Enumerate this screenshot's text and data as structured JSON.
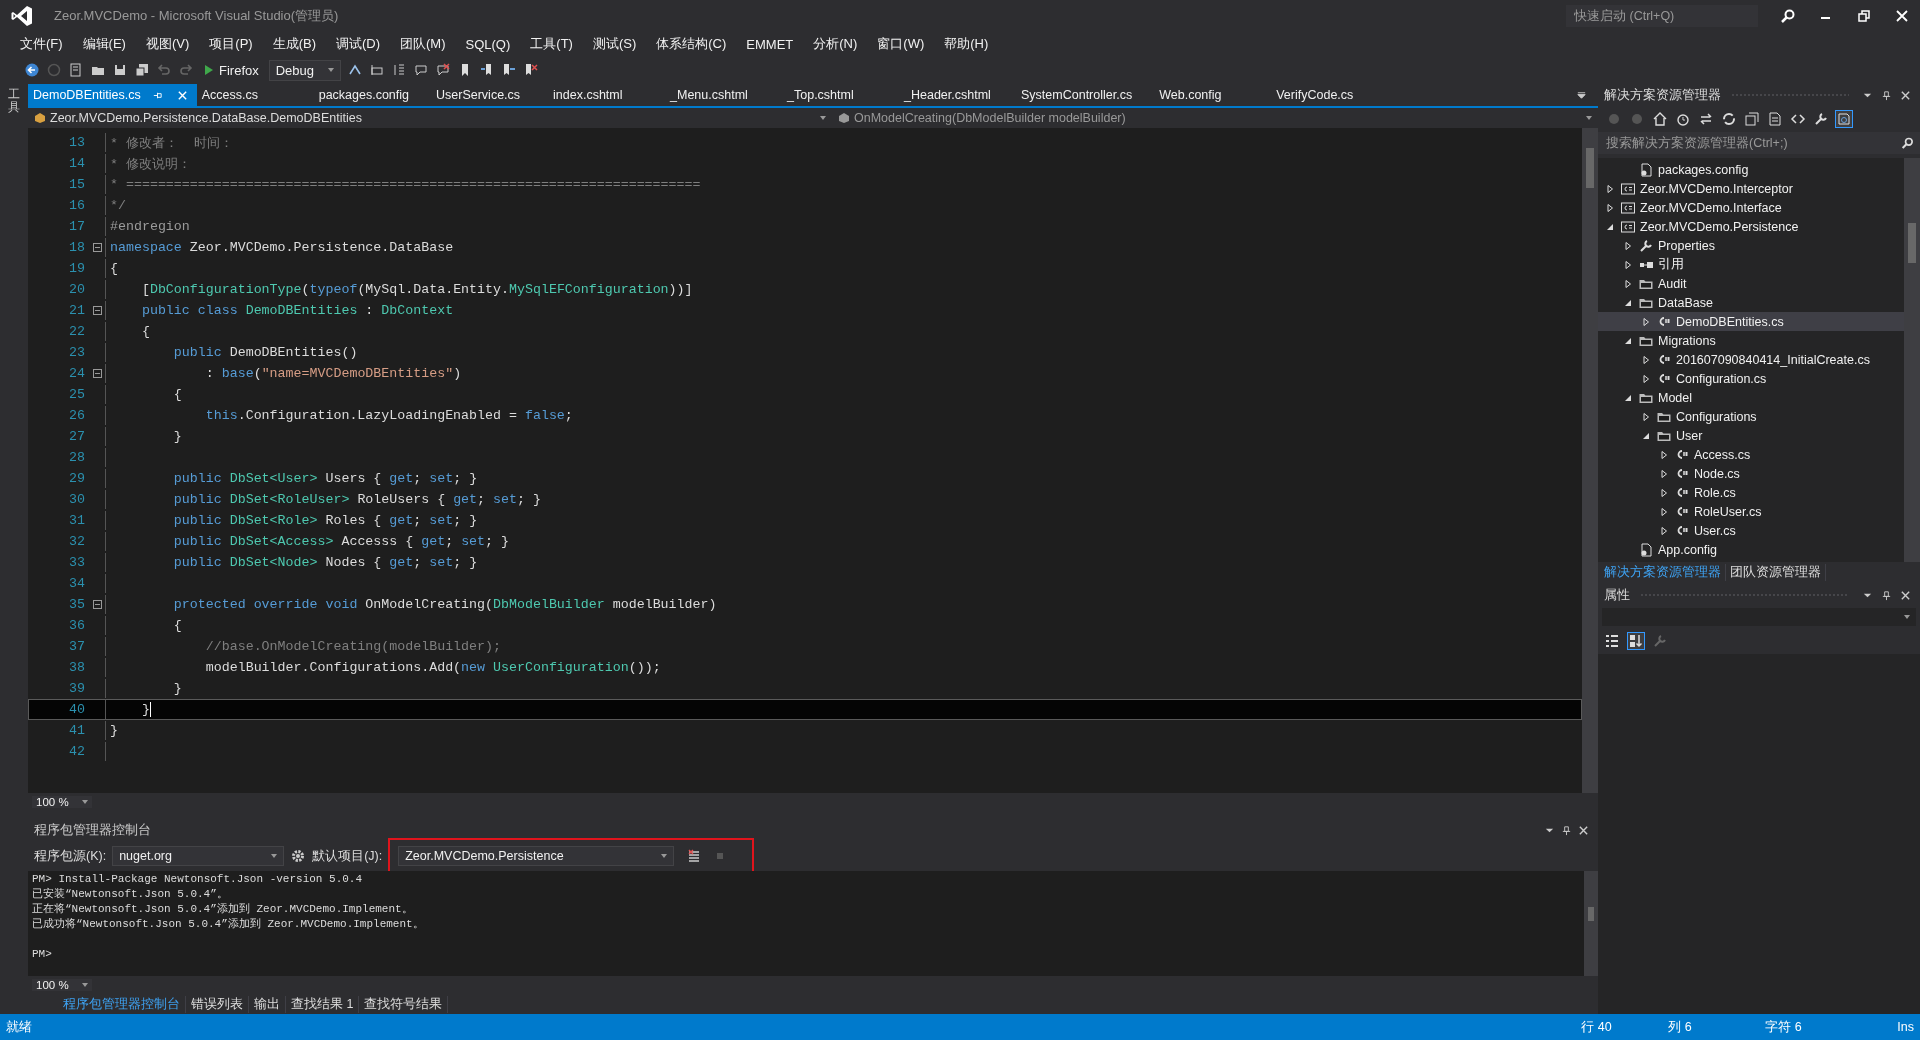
{
  "window": {
    "title": "Zeor.MVCDemo - Microsoft Visual Studio(管理员)",
    "quick_launch": {
      "placeholder": "快速启动 (Ctrl+Q)"
    }
  },
  "menu": [
    "文件(F)",
    "编辑(E)",
    "视图(V)",
    "项目(P)",
    "生成(B)",
    "调试(D)",
    "团队(M)",
    "SQL(Q)",
    "工具(T)",
    "测试(S)",
    "体系结构(C)",
    "EMMET",
    "分析(N)",
    "窗口(W)",
    "帮助(H)"
  ],
  "toolbar": {
    "browser": "Firefox",
    "configuration": "Debug"
  },
  "left_strip": {
    "label": "工具"
  },
  "tabs": [
    {
      "label": "DemoDBEntities.cs",
      "selected": true
    },
    {
      "label": "Access.cs",
      "selected": false
    },
    {
      "label": "packages.config",
      "selected": false
    },
    {
      "label": "UserService.cs",
      "selected": false
    },
    {
      "label": "index.cshtml",
      "selected": false
    },
    {
      "label": "_Menu.cshtml",
      "selected": false
    },
    {
      "label": "_Top.cshtml",
      "selected": false
    },
    {
      "label": "_Header.cshtml",
      "selected": false
    },
    {
      "label": "SystemController.cs",
      "selected": false
    },
    {
      "label": "Web.config",
      "selected": false
    },
    {
      "label": "VerifyCode.cs",
      "selected": false
    }
  ],
  "navigation": {
    "type": "Zeor.MVCDemo.Persistence.DataBase.DemoDBEntities",
    "member": "OnModelCreating(DbModelBuilder modelBuilder)"
  },
  "code_lines": [
    {
      "n": "13",
      "foldable": false,
      "current": false,
      "tokens": [
        {
          "kind": "comment",
          "text": "* 修改者：  时间："
        }
      ]
    },
    {
      "n": "14",
      "foldable": false,
      "current": false,
      "tokens": [
        {
          "kind": "comment",
          "text": "* 修改说明："
        }
      ]
    },
    {
      "n": "15",
      "foldable": false,
      "current": false,
      "tokens": [
        {
          "kind": "comment",
          "text": "* ========================================================================"
        }
      ]
    },
    {
      "n": "16",
      "foldable": false,
      "current": false,
      "tokens": [
        {
          "kind": "comment",
          "text": "*/"
        }
      ]
    },
    {
      "n": "17",
      "foldable": false,
      "current": false,
      "tokens": [
        {
          "kind": "pre",
          "text": "#endregion"
        }
      ]
    },
    {
      "n": "18",
      "foldable": true,
      "current": false,
      "tokens": [
        {
          "kind": "keyword",
          "text": "namespace"
        },
        {
          "kind": "plain",
          "text": " Zeor.MVCDemo.Persistence.DataBase"
        }
      ]
    },
    {
      "n": "19",
      "foldable": false,
      "current": false,
      "tokens": [
        {
          "kind": "plain",
          "text": "{"
        }
      ]
    },
    {
      "n": "20",
      "foldable": false,
      "current": false,
      "tokens": [
        {
          "kind": "plain",
          "text": "    ["
        },
        {
          "kind": "type",
          "text": "DbConfigurationType"
        },
        {
          "kind": "plain",
          "text": "("
        },
        {
          "kind": "keyword",
          "text": "typeof"
        },
        {
          "kind": "plain",
          "text": "(MySql.Data.Entity."
        },
        {
          "kind": "type",
          "text": "MySqlEFConfiguration"
        },
        {
          "kind": "plain",
          "text": "))]"
        }
      ]
    },
    {
      "n": "21",
      "foldable": true,
      "current": false,
      "tokens": [
        {
          "kind": "keyword",
          "text": "    public class "
        },
        {
          "kind": "type",
          "text": "DemoDBEntities"
        },
        {
          "kind": "plain",
          "text": " : "
        },
        {
          "kind": "type",
          "text": "DbContext"
        }
      ]
    },
    {
      "n": "22",
      "foldable": false,
      "current": false,
      "tokens": [
        {
          "kind": "plain",
          "text": "    {"
        }
      ]
    },
    {
      "n": "23",
      "foldable": false,
      "current": false,
      "tokens": [
        {
          "kind": "keyword",
          "text": "        public"
        },
        {
          "kind": "plain",
          "text": " DemoDBEntities()"
        }
      ]
    },
    {
      "n": "24",
      "foldable": true,
      "current": false,
      "tokens": [
        {
          "kind": "plain",
          "text": "            : "
        },
        {
          "kind": "keyword",
          "text": "base"
        },
        {
          "kind": "plain",
          "text": "("
        },
        {
          "kind": "string",
          "text": "\"name=MVCDemoDBEntities\""
        },
        {
          "kind": "plain",
          "text": ")"
        }
      ]
    },
    {
      "n": "25",
      "foldable": false,
      "current": false,
      "tokens": [
        {
          "kind": "plain",
          "text": "        {"
        }
      ]
    },
    {
      "n": "26",
      "foldable": false,
      "current": false,
      "tokens": [
        {
          "kind": "keyword",
          "text": "            this"
        },
        {
          "kind": "plain",
          "text": ".Configuration.LazyLoadingEnabled = "
        },
        {
          "kind": "keyword",
          "text": "false"
        },
        {
          "kind": "plain",
          "text": ";"
        }
      ]
    },
    {
      "n": "27",
      "foldable": false,
      "current": false,
      "tokens": [
        {
          "kind": "plain",
          "text": "        }"
        }
      ]
    },
    {
      "n": "28",
      "foldable": false,
      "current": false
    },
    {
      "n": "29",
      "foldable": false,
      "current": false,
      "tokens": [
        {
          "kind": "keyword",
          "text": "        public "
        },
        {
          "kind": "type",
          "text": "DbSet<User>"
        },
        {
          "kind": "plain",
          "text": " Users { "
        },
        {
          "kind": "keyword",
          "text": "get"
        },
        {
          "kind": "plain",
          "text": "; "
        },
        {
          "kind": "keyword",
          "text": "set"
        },
        {
          "kind": "plain",
          "text": "; }"
        }
      ]
    },
    {
      "n": "30",
      "foldable": false,
      "current": false,
      "tokens": [
        {
          "kind": "keyword",
          "text": "        public "
        },
        {
          "kind": "type",
          "text": "DbSet<RoleUser>"
        },
        {
          "kind": "plain",
          "text": " RoleUsers { "
        },
        {
          "kind": "keyword",
          "text": "get"
        },
        {
          "kind": "plain",
          "text": "; "
        },
        {
          "kind": "keyword",
          "text": "set"
        },
        {
          "kind": "plain",
          "text": "; }"
        }
      ]
    },
    {
      "n": "31",
      "foldable": false,
      "current": false,
      "tokens": [
        {
          "kind": "keyword",
          "text": "        public "
        },
        {
          "kind": "type",
          "text": "DbSet<Role>"
        },
        {
          "kind": "plain",
          "text": " Roles { "
        },
        {
          "kind": "keyword",
          "text": "get"
        },
        {
          "kind": "plain",
          "text": "; "
        },
        {
          "kind": "keyword",
          "text": "set"
        },
        {
          "kind": "plain",
          "text": "; }"
        }
      ]
    },
    {
      "n": "32",
      "foldable": false,
      "current": false,
      "tokens": [
        {
          "kind": "keyword",
          "text": "        public "
        },
        {
          "kind": "type",
          "text": "DbSet<Access>"
        },
        {
          "kind": "plain",
          "text": " Accesss { "
        },
        {
          "kind": "keyword",
          "text": "get"
        },
        {
          "kind": "plain",
          "text": "; "
        },
        {
          "kind": "keyword",
          "text": "set"
        },
        {
          "kind": "plain",
          "text": "; }"
        }
      ]
    },
    {
      "n": "33",
      "foldable": false,
      "current": false,
      "tokens": [
        {
          "kind": "keyword",
          "text": "        public "
        },
        {
          "kind": "type",
          "text": "DbSet<Node>"
        },
        {
          "kind": "plain",
          "text": " Nodes { "
        },
        {
          "kind": "keyword",
          "text": "get"
        },
        {
          "kind": "plain",
          "text": "; "
        },
        {
          "kind": "keyword",
          "text": "set"
        },
        {
          "kind": "plain",
          "text": "; }"
        }
      ]
    },
    {
      "n": "34",
      "foldable": false,
      "current": false
    },
    {
      "n": "35",
      "foldable": true,
      "current": false,
      "tokens": [
        {
          "kind": "keyword",
          "text": "        protected override void"
        },
        {
          "kind": "plain",
          "text": " OnModelCreating("
        },
        {
          "kind": "type",
          "text": "DbModelBuilder"
        },
        {
          "kind": "plain",
          "text": " modelBuilder)"
        }
      ]
    },
    {
      "n": "36",
      "foldable": false,
      "current": false,
      "tokens": [
        {
          "kind": "plain",
          "text": "        {"
        }
      ]
    },
    {
      "n": "37",
      "foldable": false,
      "current": false,
      "tokens": [
        {
          "kind": "comment",
          "text": "            //base.OnModelCreating(modelBuilder);"
        }
      ]
    },
    {
      "n": "38",
      "foldable": false,
      "current": false,
      "tokens": [
        {
          "kind": "plain",
          "text": "            modelBuilder.Configurations.Add("
        },
        {
          "kind": "keyword",
          "text": "new "
        },
        {
          "kind": "type",
          "text": "UserConfiguration"
        },
        {
          "kind": "plain",
          "text": "());"
        }
      ]
    },
    {
      "n": "39",
      "foldable": false,
      "current": false,
      "tokens": [
        {
          "kind": "plain",
          "text": "        }"
        }
      ]
    },
    {
      "n": "40",
      "foldable": false,
      "current": true,
      "tokens": [
        {
          "kind": "plain",
          "text": "    }"
        }
      ]
    },
    {
      "n": "41",
      "foldable": false,
      "current": false,
      "tokens": [
        {
          "kind": "plain",
          "text": "}"
        }
      ]
    },
    {
      "n": "42",
      "foldable": false,
      "current": false
    }
  ],
  "editor_zoom": "100 %",
  "solution_explorer": {
    "title": "解决方案资源管理器",
    "search": {
      "placeholder": "搜索解决方案资源管理器(Ctrl+;)"
    },
    "continued_items": [
      {
        "label": "packages.config",
        "kind": "config",
        "selected": false
      }
    ],
    "items": [
      {
        "label": "Zeor.MVCDemo.Interceptor",
        "kind": "project",
        "expanded": false,
        "selected": false
      },
      {
        "label": "Zeor.MVCDemo.Interface",
        "kind": "project",
        "expanded": false,
        "selected": false
      },
      {
        "label": "Zeor.MVCDemo.Persistence",
        "kind": "project",
        "expanded": true,
        "selected": false,
        "children": [
          {
            "label": "Properties",
            "kind": "properties",
            "expanded": false,
            "selected": false
          },
          {
            "label": "引用",
            "kind": "references",
            "expanded": false,
            "selected": false
          },
          {
            "label": "Audit",
            "kind": "folder",
            "expanded": false,
            "selected": false
          },
          {
            "label": "DataBase",
            "kind": "folder",
            "expanded": true,
            "selected": false,
            "children": [
              {
                "label": "DemoDBEntities.cs",
                "kind": "cs",
                "expanded": false,
                "selected": true
              }
            ]
          },
          {
            "label": "Migrations",
            "kind": "folder",
            "expanded": true,
            "selected": false,
            "children": [
              {
                "label": "201607090840414_InitialCreate.cs",
                "kind": "cs",
                "expanded": false,
                "selected": false
              },
              {
                "label": "Configuration.cs",
                "kind": "cs",
                "expanded": false,
                "selected": false
              }
            ]
          },
          {
            "label": "Model",
            "kind": "folder",
            "expanded": true,
            "selected": false,
            "children": [
              {
                "label": "Configurations",
                "kind": "folder",
                "expanded": false,
                "selected": false
              },
              {
                "label": "User",
                "kind": "folder",
                "expanded": true,
                "selected": false,
                "children": [
                  {
                    "label": "Access.cs",
                    "kind": "cs",
                    "expanded": false,
                    "selected": false
                  },
                  {
                    "label": "Node.cs",
                    "kind": "cs",
                    "expanded": false,
                    "selected": false
                  },
                  {
                    "label": "Role.cs",
                    "kind": "cs",
                    "expanded": false,
                    "selected": false
                  },
                  {
                    "label": "RoleUser.cs",
                    "kind": "cs",
                    "expanded": false,
                    "selected": false
                  },
                  {
                    "label": "User.cs",
                    "kind": "cs",
                    "expanded": false,
                    "selected": false
                  }
                ]
              }
            ]
          },
          {
            "label": "App.config",
            "kind": "config",
            "selected": false
          }
        ]
      }
    ],
    "bottom_tabs": [
      {
        "label": "解决方案资源管理器",
        "selected": true
      },
      {
        "label": "团队资源管理器",
        "selected": false
      }
    ]
  },
  "properties": {
    "title": "属性"
  },
  "console": {
    "title": "程序包管理器控制台",
    "source_label": "程序包源(K):",
    "source": "nuget.org",
    "project_label": "默认项目(J):",
    "project": "Zeor.MVCDemo.Persistence",
    "highlighted": true,
    "output": [
      "PM> Install-Package Newtonsoft.Json -version 5.0.4",
      "已安装“Newtonsoft.Json 5.0.4”。",
      "正在将“Newtonsoft.Json 5.0.4”添加到 Zeor.MVCDemo.Implement。",
      "已成功将“Newtonsoft.Json 5.0.4”添加到 Zeor.MVCDemo.Implement。"
    ],
    "prompt": "PM>",
    "zoom": "100 %",
    "tabs": [
      {
        "label": "程序包管理器控制台",
        "selected": true
      },
      {
        "label": "错误列表",
        "selected": false
      },
      {
        "label": "输出",
        "selected": false
      },
      {
        "label": "查找结果 1",
        "selected": false
      },
      {
        "label": "查找符号结果",
        "selected": false
      }
    ]
  },
  "status_bar": {
    "message": "就绪",
    "line": "行 40",
    "column": "列 6",
    "char": "字符 6",
    "mode": "Ins"
  }
}
